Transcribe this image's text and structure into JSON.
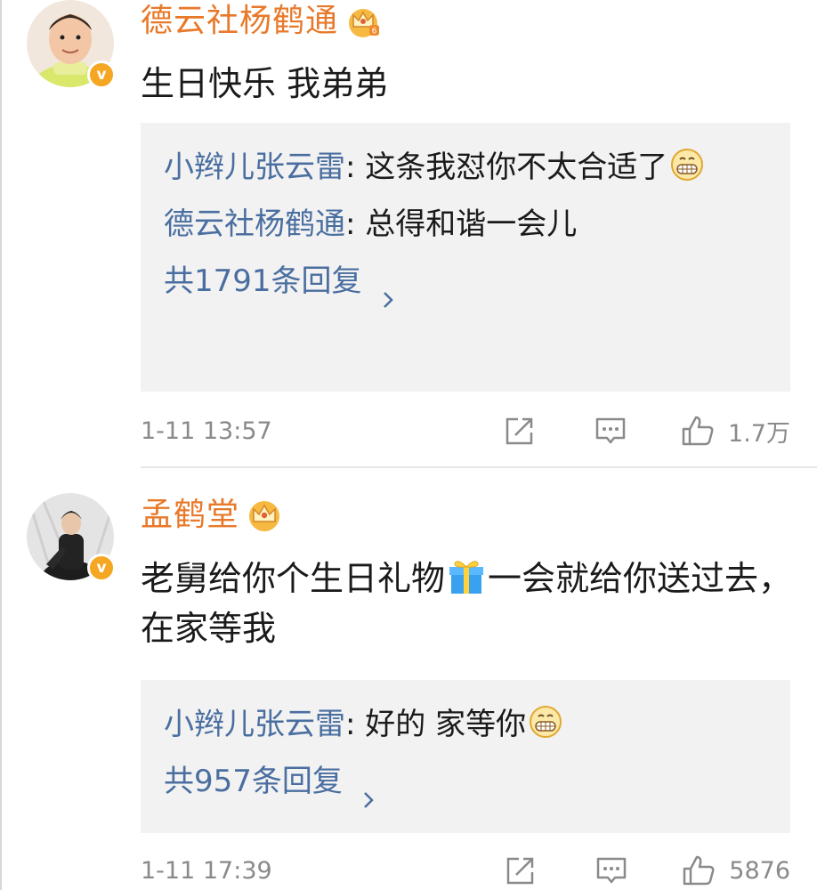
{
  "comments": [
    {
      "username": "德云社杨鹤通",
      "badge_icon": "crown-level-icon",
      "verified_icon": "verified-v-icon",
      "text": "生日快乐 我弟弟",
      "replies": [
        {
          "user": "小辫儿张云雷",
          "text": "这条我怼你不太合适了",
          "emoji": "grin-emoji-icon"
        },
        {
          "user": "德云社杨鹤通",
          "text": "总得和谐一会儿"
        }
      ],
      "more_replies": "共1791条回复",
      "time": "1-11 13:57",
      "likes": "1.7万"
    },
    {
      "username": "孟鹤堂",
      "badge_icon": "crown-level-icon",
      "verified_icon": "verified-v-icon",
      "text_before_gift": "老舅给你个生日礼物",
      "gift_icon": "gift-icon",
      "text_after_gift": "一会就给你送过去，在家等我",
      "replies": [
        {
          "user": "小辫儿张云雷",
          "text": "好的 家等你",
          "emoji": "grin-emoji-icon"
        }
      ],
      "more_replies": "共957条回复",
      "time": "1-11 17:39",
      "likes": "5876"
    }
  ],
  "colors": {
    "username": "#e8792a",
    "reply_user": "#4a6ea0",
    "reply_bg": "#f2f2f2",
    "meta": "#8a8a8a",
    "badge": "#f5a623"
  }
}
